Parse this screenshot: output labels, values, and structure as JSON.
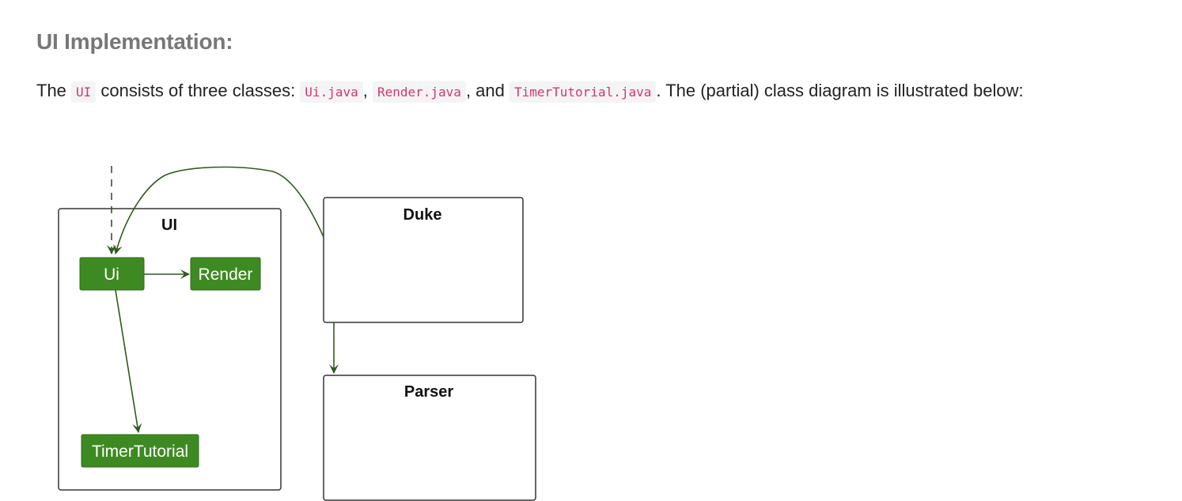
{
  "heading": "UI Implementation:",
  "paragraph": {
    "t1": "The ",
    "c1": "UI",
    "t2": " consists of three classes: ",
    "c2": "Ui.java",
    "t3": ", ",
    "c3": "Render.java",
    "t4": ", and ",
    "c4": "TimerTutorial.java",
    "t5": ". The (partial) class diagram is illustrated below:"
  },
  "diagram": {
    "package_title": "UI",
    "classes": {
      "ui": "Ui",
      "render": "Render",
      "timer_tutorial": "TimerTutorial",
      "duke": "Duke",
      "parser": "Parser"
    },
    "colors": {
      "node_fill": "#3e8a22",
      "edge": "#2f5a1e",
      "code_text": "#d2386c"
    }
  }
}
